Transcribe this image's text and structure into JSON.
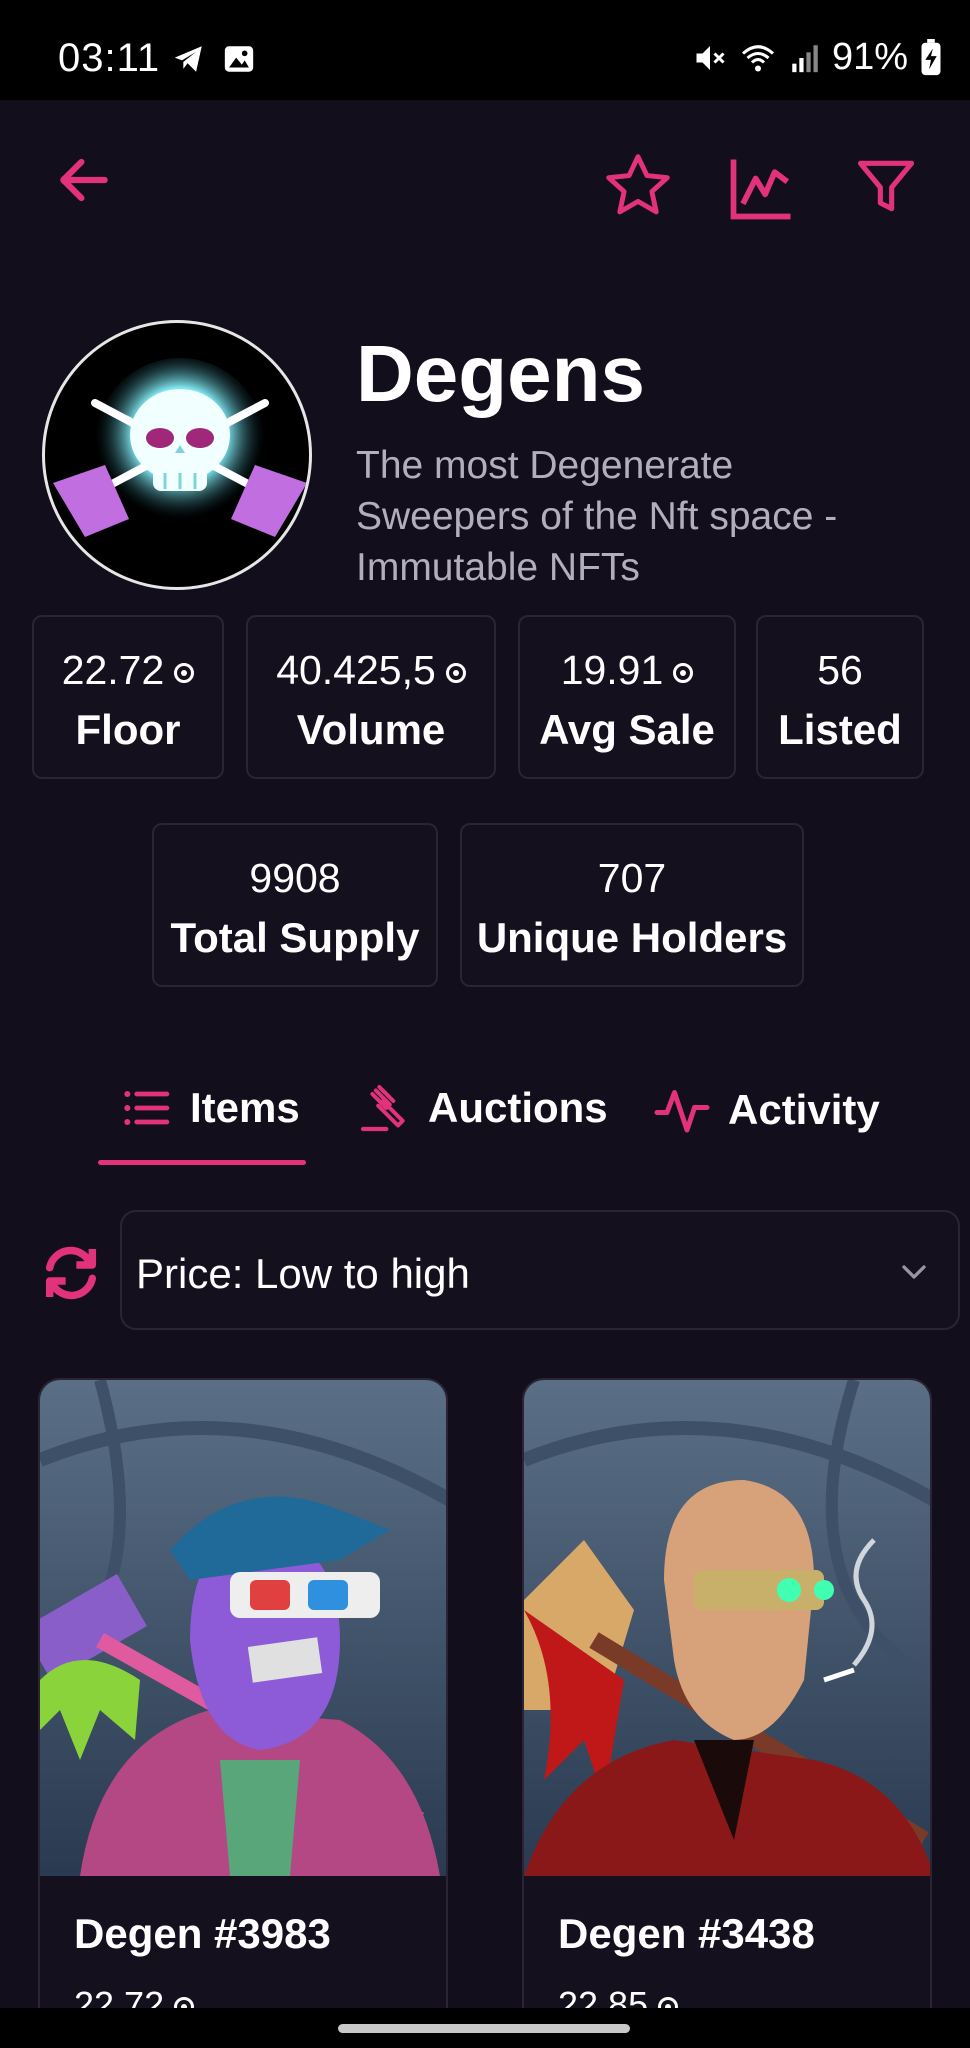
{
  "status_bar": {
    "time": "03:11",
    "battery": "91%"
  },
  "app_bar": {
    "icons": [
      "back-arrow-icon",
      "star-icon",
      "chart-icon",
      "filter-icon"
    ],
    "accent_color": "#e2327c"
  },
  "collection": {
    "name": "Degens",
    "description": "The most Degenerate Sweepers of the Nft space - Immutable NFTs"
  },
  "stats": {
    "floor": {
      "value": "22.72",
      "label": "Floor"
    },
    "volume": {
      "value": "40.425,5",
      "label": "Volume"
    },
    "avg_sale": {
      "value": "19.91",
      "label": "Avg Sale"
    },
    "listed": {
      "value": "56",
      "label": "Listed"
    },
    "total_supply": {
      "value": "9908",
      "label": "Total Supply"
    },
    "unique_holders": {
      "value": "707",
      "label": "Unique Holders"
    }
  },
  "tabs": [
    {
      "label": "Items",
      "icon": "list-icon",
      "active": true
    },
    {
      "label": "Auctions",
      "icon": "gavel-icon",
      "active": false
    },
    {
      "label": "Activity",
      "icon": "activity-icon",
      "active": false
    }
  ],
  "sort": {
    "selected": "Price: Low to high"
  },
  "items": [
    {
      "name": "Degen #3983",
      "price": "22.72"
    },
    {
      "name": "Degen #3438",
      "price": "22.85"
    }
  ]
}
